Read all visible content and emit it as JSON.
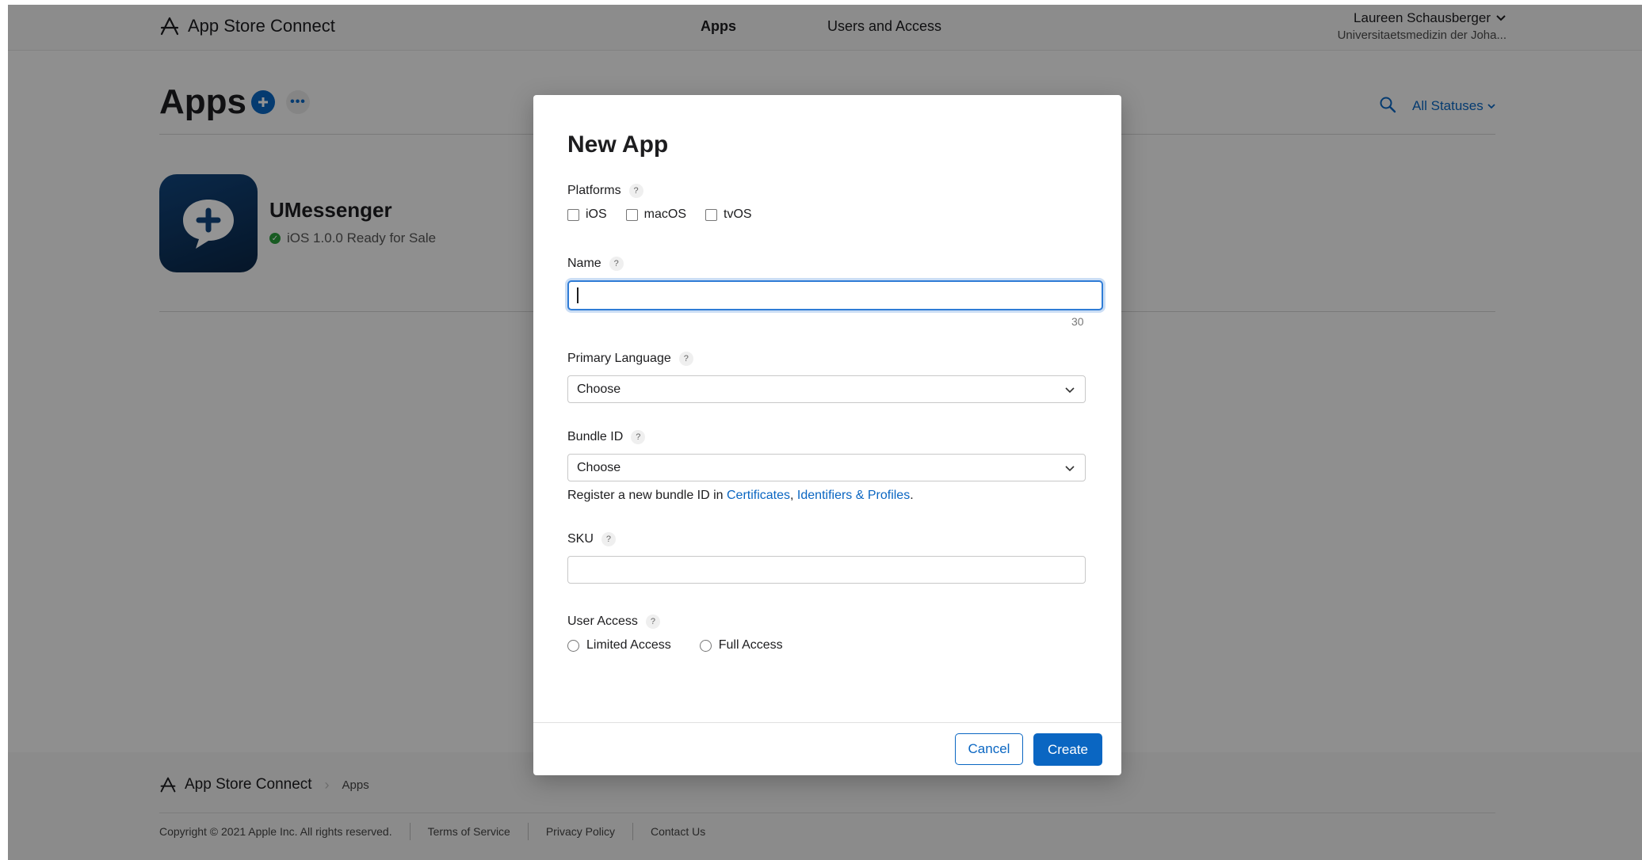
{
  "header": {
    "brand": "App Store Connect",
    "nav": [
      {
        "label": "Apps"
      },
      {
        "label": "Users and Access"
      }
    ],
    "user": {
      "name": "Laureen Schausberger",
      "org": "Universitaetsmedizin der Joha..."
    }
  },
  "page": {
    "title": "Apps",
    "more_label": "•••",
    "status_filter": "All Statuses"
  },
  "app": {
    "name": "UMessenger",
    "status": "iOS 1.0.0 Ready for Sale"
  },
  "footer": {
    "brand": "App Store Connect",
    "crumb": "Apps",
    "copyright": "Copyright © 2021 Apple Inc. All rights reserved.",
    "links": [
      "Terms of Service",
      "Privacy Policy",
      "Contact Us"
    ]
  },
  "modal": {
    "title": "New App",
    "help_glyph": "?",
    "platforms_label": "Platforms",
    "platforms": [
      "iOS",
      "macOS",
      "tvOS"
    ],
    "name_label": "Name",
    "name_value": "",
    "name_char_limit": "30",
    "language_label": "Primary Language",
    "language_value": "Choose",
    "bundle_label": "Bundle ID",
    "bundle_value": "Choose",
    "bundle_hint_prefix": "Register a new bundle ID in ",
    "bundle_hint_link1": "Certificates",
    "bundle_hint_comma": ", ",
    "bundle_hint_link2": "Identifiers & Profiles",
    "bundle_hint_suffix": ".",
    "sku_label": "SKU",
    "sku_value": "",
    "access_label": "User Access",
    "access_options": [
      "Limited Access",
      "Full Access"
    ],
    "cancel_label": "Cancel",
    "create_label": "Create"
  },
  "colors": {
    "accent": "#0a66c2",
    "focus": "#2f7cd6",
    "status_green": "#2a9d3c",
    "overlay": "rgba(0,0,0,0.42)"
  },
  "icons": {
    "brand": "app-store-a-icon",
    "add": "plus-icon",
    "more": "ellipsis-icon",
    "search": "search-icon",
    "chevron": "chevron-down-icon",
    "status": "checkmark-icon",
    "app": "chat-bubble-plus-icon"
  }
}
